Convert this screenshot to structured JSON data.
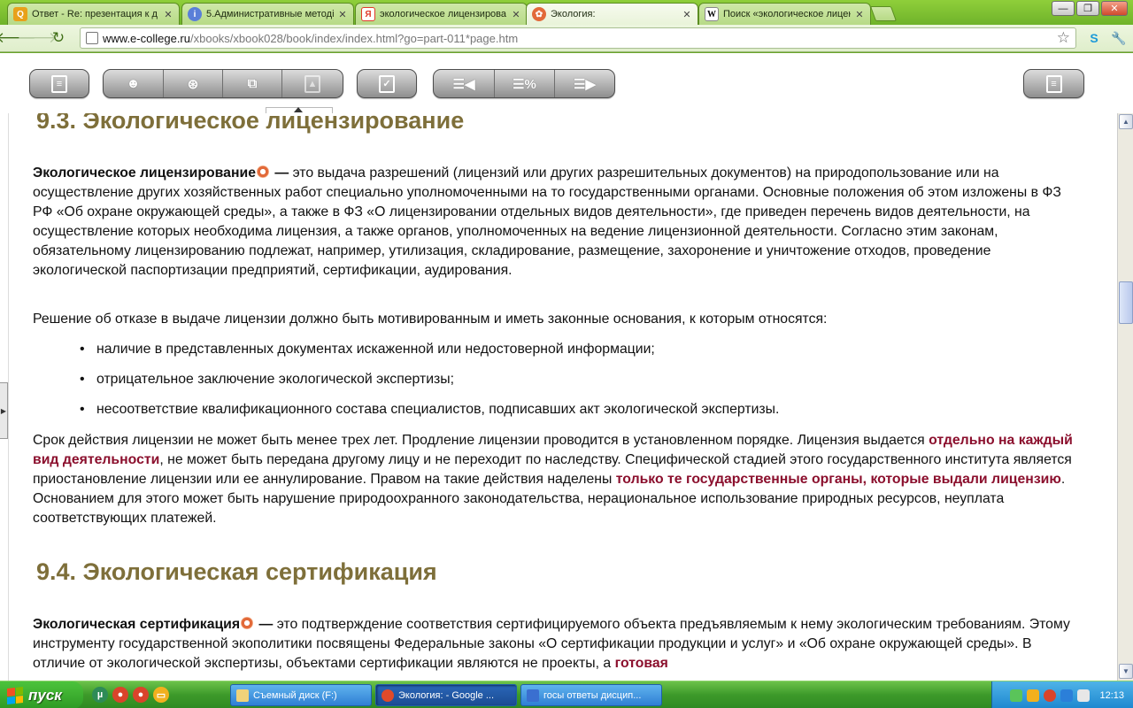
{
  "browser": {
    "tabs": [
      {
        "title": "Ответ - Re: презентация к д",
        "icon": "Q",
        "icon_color": "#e8a11a"
      },
      {
        "title": "5.Административные методі",
        "icon": "i",
        "icon_color": "#5a7fd8"
      },
      {
        "title": "экологическое лицензирова",
        "icon": "Я",
        "icon_color": "#e03a2a"
      },
      {
        "title": "Экология:",
        "icon": "✿",
        "icon_color": "#e26a3a",
        "active": true
      },
      {
        "title": "Поиск «экологическое лицен",
        "icon": "W",
        "icon_color": "#ffffff"
      }
    ],
    "window_buttons": {
      "minimize": "—",
      "maximize": "❐",
      "close": "✕"
    },
    "url": {
      "domain": "www.e-college.ru",
      "path": "/xbooks/xbook028/book/index/index.html?go=part-011*page.htm"
    }
  },
  "book_toolbar": {
    "percent_label": "%"
  },
  "content": {
    "section1": {
      "heading": "9.3. Экологическое лицензирование",
      "p1_term": "Экологическое лицензирование",
      "p1_dash": " — ",
      "p1_text": "это выдача разрешений (лицензий или других разрешительных документов) на природопользование или на осуществление других хозяйственных работ специально уполномоченными на то государственными органами. Основные положения об этом изложены в ФЗ РФ «Об охране окружающей среды», а также в ФЗ «О лицензировании отдельных видов деятельности», где приведен перечень видов деятельности, на осуществление которых необходима лицензия, а также органов, уполномоченных на ведение лицензионной деятельности. Согласно этим законам, обязательному лицензированию подлежат, например, утилизация, складирование, размещение, захоронение и уничтожение отходов, проведение экологической паспортизации предприятий, сертификации, аудирования.",
      "p2": "Решение об отказе в выдаче лицензии должно быть мотивированным и иметь законные основания, к которым относятся:",
      "bullets": [
        "наличие в представленных документах искаженной или недостоверной информации;",
        "отрицательное заключение экологической экспертизы;",
        "несоответствие квалификационного состава специалистов, подписавших акт экологической экспертизы."
      ],
      "p3_a": "Срок действия лицензии не может быть менее трех лет. Продление лицензии проводится в установленном порядке. Лицензия выдается ",
      "p3_hl1": "отдельно на каждый вид деятельности",
      "p3_b": ", не может быть передана другому лицу и не переходит по наследству. Специфической стадией этого государственного института является приостановление лицензии или ее аннулирование. Правом на такие действия наделены ",
      "p3_hl2": "только те государственные органы, которые выдали лицензию",
      "p3_c": ". Основанием для этого может быть нарушение природоохранного законодательства, нерациональное использование природных ресурсов, неуплата соответствующих платежей."
    },
    "section2": {
      "heading": "9.4. Экологическая сертификация",
      "p1_term": "Экологическая сертификация",
      "p1_dash": " — ",
      "p1_text": "это подтверждение соответствия сертифицируемого объекта предъявляемым к нему экологическим требованиям. Этому инструменту государственной экополитики посвящены Федеральные законы «О сертификации продукции и услуг» и «Об охране окружающей среды». В отличие от экологической экспертизы, объектами сертификации являются не проекты, а ",
      "p1_hl": "готовая"
    }
  },
  "taskbar": {
    "start_label": "пуск",
    "tasks": [
      {
        "label": "Съемный диск (F:)",
        "icon_color": "#f0d27a"
      },
      {
        "label": "Экология: - Google ...",
        "icon_color": "#e04a2a",
        "active": true
      },
      {
        "label": "госы ответы дисцип...",
        "icon_color": "#3a6fd0"
      }
    ],
    "clock": "12:13"
  }
}
